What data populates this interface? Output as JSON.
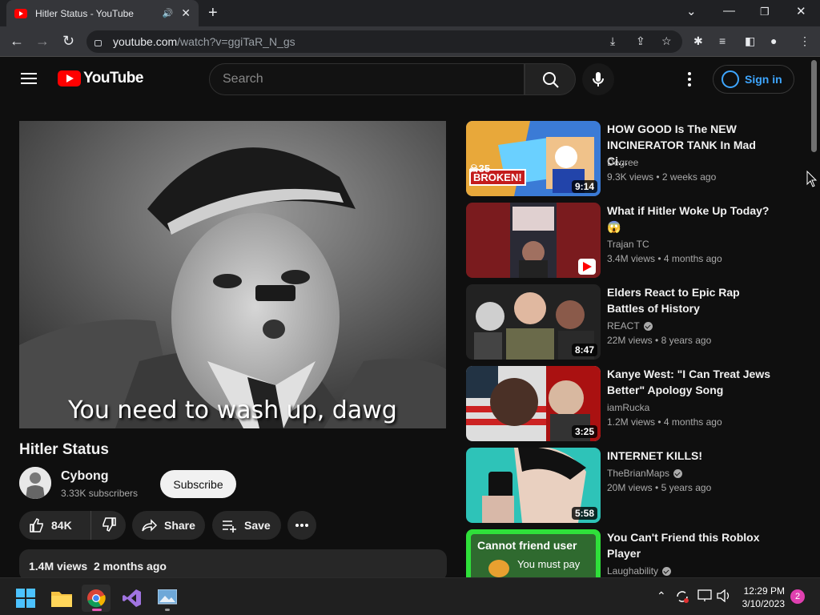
{
  "browser": {
    "tab_title": "Hitler Status - YouTube",
    "url_domain": "youtube.com",
    "url_path": "/watch?v=ggiTaR_N_gs"
  },
  "youtube": {
    "logo_text": "YouTube",
    "search_placeholder": "Search",
    "sign_in_label": "Sign in"
  },
  "video": {
    "caption": "You need to wash up, dawg",
    "title": "Hitler Status",
    "channel": "Cybong",
    "subscribers": "3.33K subscribers",
    "subscribe_label": "Subscribe",
    "likes": "84K",
    "share_label": "Share",
    "save_label": "Save",
    "views": "1.4M views",
    "date": "2 months ago"
  },
  "recommendations": [
    {
      "title": "HOW GOOD Is The NEW INCINERATOR TANK In Mad Ci...",
      "channel": "Degree",
      "views": "9.3K views",
      "age": "2 weeks ago",
      "duration": "9:14",
      "verified": false,
      "thumb_text": "☠35 BROKEN!"
    },
    {
      "title": "What if Hitler Woke Up Today? 😱",
      "channel": "Trajan TC",
      "views": "3.4M views",
      "age": "4 months ago",
      "duration": "",
      "verified": false,
      "thumb_text": ""
    },
    {
      "title": "Elders React to Epic Rap Battles of History",
      "channel": "REACT",
      "views": "22M views",
      "age": "8 years ago",
      "duration": "8:47",
      "verified": true,
      "thumb_text": ""
    },
    {
      "title": "Kanye West: \"I Can Treat Jews Better\" Apology Song",
      "channel": "iamRucka",
      "views": "1.2M views",
      "age": "4 months ago",
      "duration": "3:25",
      "verified": false,
      "thumb_text": ""
    },
    {
      "title": "INTERNET KILLS!",
      "channel": "TheBrianMaps",
      "views": "20M views",
      "age": "5 years ago",
      "duration": "5:58",
      "verified": true,
      "thumb_text": ""
    },
    {
      "title": "You Can't Friend this Roblox Player",
      "channel": "Laughability",
      "views": "",
      "age": "",
      "duration": "",
      "verified": true,
      "thumb_text": "Cannot friend user|You must pay"
    }
  ],
  "taskbar": {
    "time": "12:29 PM",
    "date": "3/10/2023",
    "notifications": "2"
  },
  "colors": {
    "youtube_red": "#ff0000",
    "link_blue": "#3ea6ff",
    "background": "#0f0f0f"
  }
}
